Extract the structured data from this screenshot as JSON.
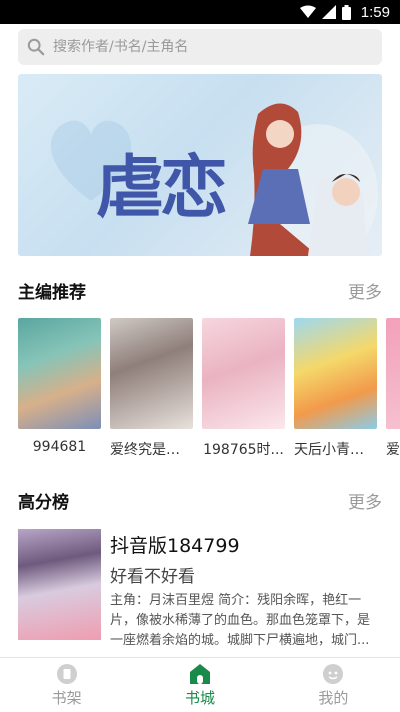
{
  "status_bar": {
    "time": "1:59"
  },
  "search": {
    "placeholder": "搜索作者/书名/主角名"
  },
  "banner": {
    "title": "虐恋"
  },
  "sections": {
    "editor_pick": {
      "title": "主编推荐",
      "more": "更多"
    },
    "top_rated": {
      "title": "高分榜",
      "more": "更多"
    }
  },
  "editor_books": [
    {
      "title": "994681"
    },
    {
      "title": "爱终究是场..."
    },
    {
      "title": "198765时..."
    },
    {
      "title": "天后小青梅..."
    },
    {
      "title": "爱"
    }
  ],
  "top_book": {
    "title": "抖音版184799",
    "subtitle": "好看不好看",
    "description": "主角：月沫百里煜  简介：残阳余晖，艳红一片，像被水稀薄了的血色。那血色笼罩下，是一座燃着余焰的城。城脚下尸横遍地，城门..."
  },
  "tabs": [
    {
      "label": "书架",
      "active": false
    },
    {
      "label": "书城",
      "active": true
    },
    {
      "label": "我的",
      "active": false
    }
  ],
  "colors": {
    "accent": "#1a8a4a",
    "banner_title": "#3f56a9"
  }
}
